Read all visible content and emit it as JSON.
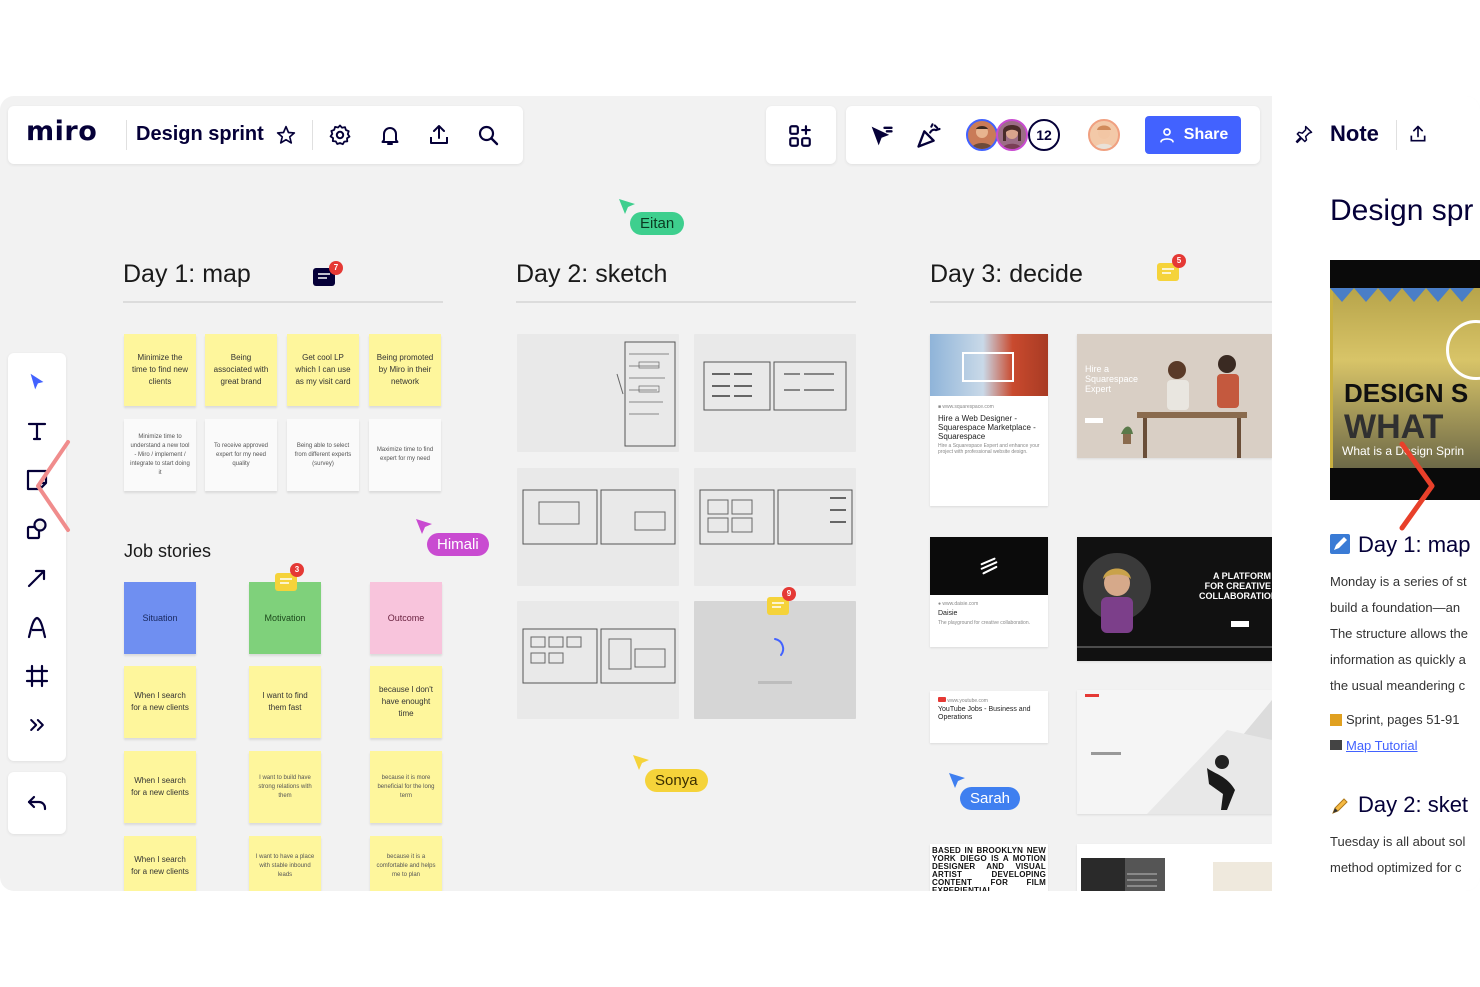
{
  "app": {
    "logo": "miro",
    "board_name": "Design sprint"
  },
  "toolbar": {
    "share_label": "Share",
    "collaborators_count": "12"
  },
  "note_panel": {
    "tab_label": "Note",
    "heading": "Design spr",
    "video_overlay_title": "DESIGN S",
    "video_overlay_sub": "WHAT",
    "video_caption": "What is a Design Sprin",
    "day1_title": "Day 1: map",
    "day1_lines": [
      "Monday is a series of st",
      "build a foundation—an",
      "The structure allows the",
      "information as quickly a",
      "the usual meandering c"
    ],
    "link1_text": "Sprint, pages 51-91",
    "link2_text": "Map Tutorial",
    "day2_title": "Day 2: sket",
    "day2_lines": [
      "Tuesday is all about sol",
      "method optimized for c"
    ]
  },
  "frames": {
    "day1": "Day 1: map",
    "day2": "Day 2: sketch",
    "day3": "Day 3: decide",
    "job_stories": "Job stories"
  },
  "cursors": {
    "eitan": "Eitan",
    "himali": "Himali",
    "sonya": "Sonya",
    "sarah": "Sarah"
  },
  "comment_badges": {
    "day1": "7",
    "day3": "5",
    "motivation": "3",
    "sketch": "9"
  },
  "day1_stickies_top": [
    "Minimize the time to find new clients",
    "Being associated with great brand",
    "Get cool LP which I can use as my visit card",
    "Being promoted by Miro in their network"
  ],
  "day1_stickies_bottom": [
    "Minimize time to understand a new tool - Miro / implement / integrate to start doing it",
    "To receive approved expert for my need quality",
    "Being able to select from different experts (survey)",
    "Maximize time to find expert for my need"
  ],
  "job_story_headers": [
    "Situation",
    "Motivation",
    "Outcome"
  ],
  "job_story_rows": [
    [
      "When I search for a new clients",
      "I want to find them fast",
      "because I don't have enought time"
    ],
    [
      "When I search for a new clients",
      "I want to build have strong relations with them",
      "because it is more beneficial for the long term"
    ],
    [
      "When I search for a new clients",
      "I want to have a place with stable inbound leads",
      "because it is a comfortable and helps me to plan"
    ]
  ],
  "day3_sites": {
    "web_designer_title": "Hire a Web Designer - Squarespace Marketplace - Squarespace",
    "squarespace_hero": "Hire a Squarespace Expert",
    "daisie_title": "Daisie",
    "daisie_sub": "The playground for creative collaboration.",
    "platform_title": "A PLATFORM FOR CREATIVE COLLABORATION",
    "youtube_title": "YouTube Jobs - Business and Operations",
    "brooklyn_text": "BASED IN BROOKLYN NEW YORK DIEGO IS A MOTION DESIGNER AND VISUAL ARTIST DEVELOPING CONTENT FOR FILM EXPERIENTIAL"
  },
  "colors": {
    "accent": "#4262ff",
    "sticky_yellow": "#fef69c",
    "eitan": "#3ecf8e",
    "himali": "#c94bd1",
    "sonya": "#f5d33a",
    "sarah": "#3f7ff0"
  }
}
